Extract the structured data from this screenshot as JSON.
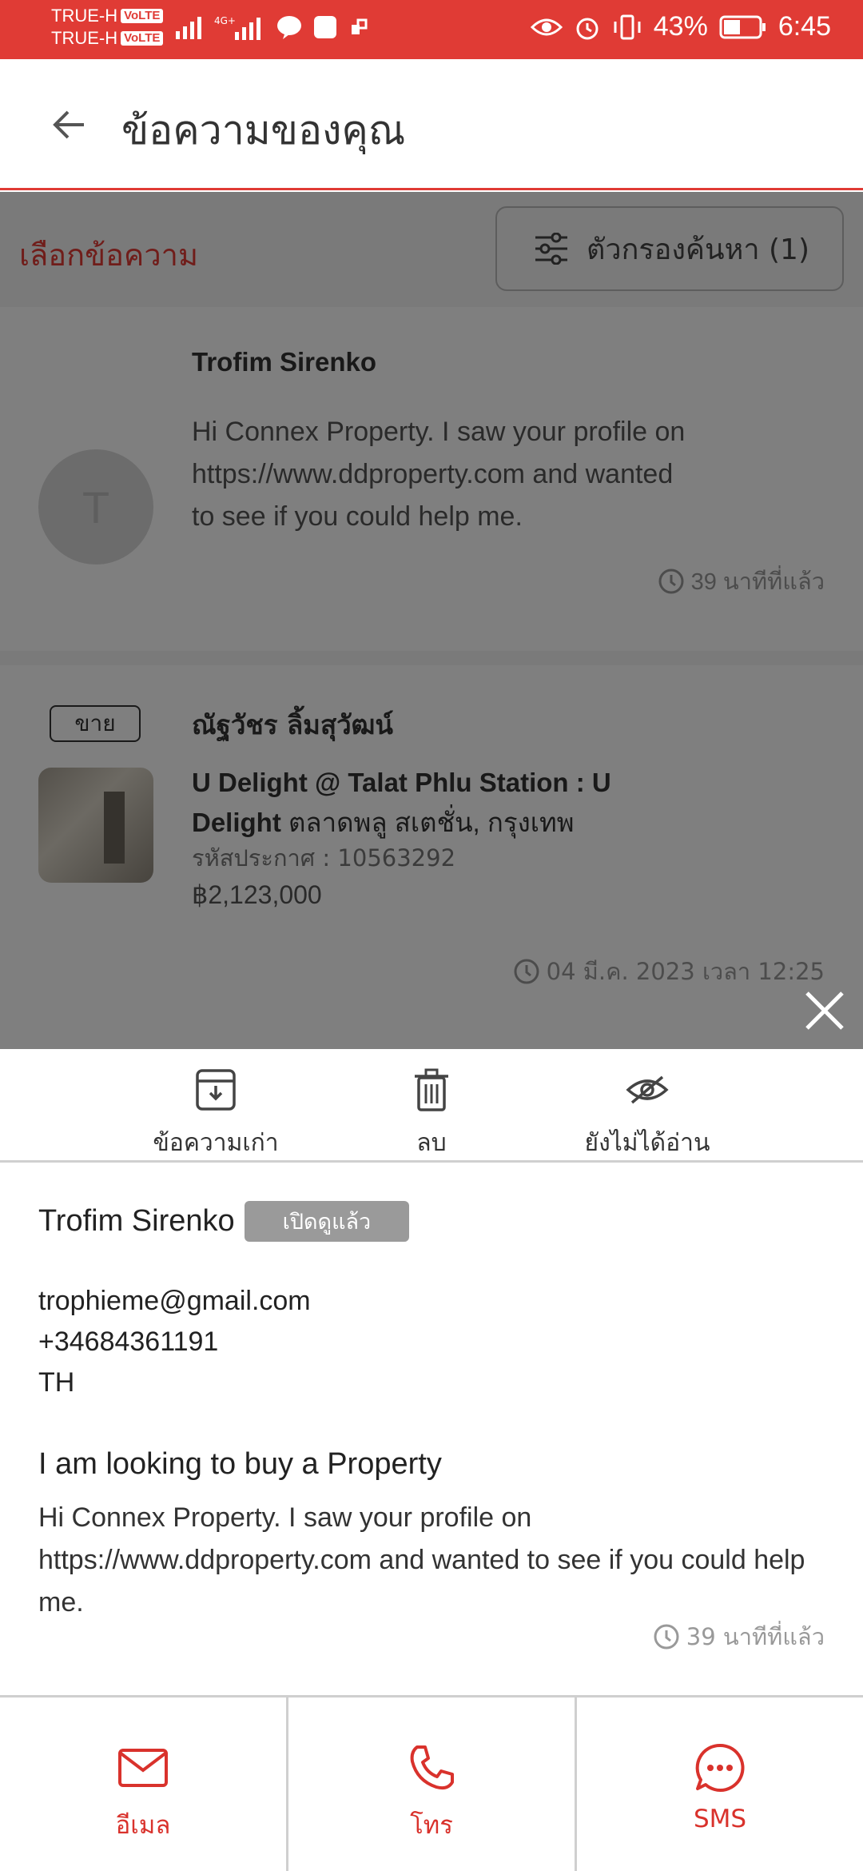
{
  "status_bar": {
    "carrier1": "TRUE-H",
    "carrier2": "TRUE-H",
    "volte": "VoLTE",
    "battery": "43%",
    "time": "6:45"
  },
  "app_bar": {
    "title": "ข้อความของคุณ"
  },
  "filter_row": {
    "select_label": "เลือกข้อความ",
    "filter_label": "ตัวกรองค้นหา (1)"
  },
  "messages": [
    {
      "avatar_letter": "T",
      "name": "Trofim Sirenko",
      "text": "Hi Connex Property. I saw your profile on https://www.ddproperty.com and wanted to see if you could help me.",
      "time": "39 นาทีที่แล้ว"
    },
    {
      "tag": "ขาย",
      "name": "ณัฐวัชร ลิ้มสุวัฒน์",
      "listing_title_bold": "U Delight @ Talat Phlu Station : U Delight",
      "listing_title_rest": " ตลาดพลู สเตชั่น, กรุงเทพ",
      "listing_code": "รหัสประกาศ : 10563292",
      "price": "฿2,123,000",
      "time": "04 มี.ค. 2023 เวลา 12:25"
    }
  ],
  "sheet": {
    "actions": {
      "archive": "ข้อความเก่า",
      "delete": "ลบ",
      "unread": "ยังไม่ได้อ่าน"
    },
    "detail": {
      "name": "Trofim Sirenko",
      "badge": "เปิดดูแล้ว",
      "email": "trophieme@gmail.com",
      "phone": "+34684361191",
      "country": "TH",
      "subject": "I am looking to buy a Property",
      "body": "Hi Connex Property. I saw your profile on https://www.ddproperty.com and wanted to see if you could help me.",
      "time": "39 นาทีที่แล้ว"
    }
  },
  "bottom_bar": {
    "email": "อีเมล",
    "call": "โทร",
    "sms": "SMS"
  },
  "colors": {
    "accent": "#e03b35",
    "overlay": "rgba(0,0,0,0.5)"
  },
  "icons": [
    "back-arrow-icon",
    "filter-icon",
    "clock-icon",
    "close-icon",
    "archive-icon",
    "trash-icon",
    "eye-off-icon",
    "mail-icon",
    "phone-icon",
    "sms-icon"
  ]
}
